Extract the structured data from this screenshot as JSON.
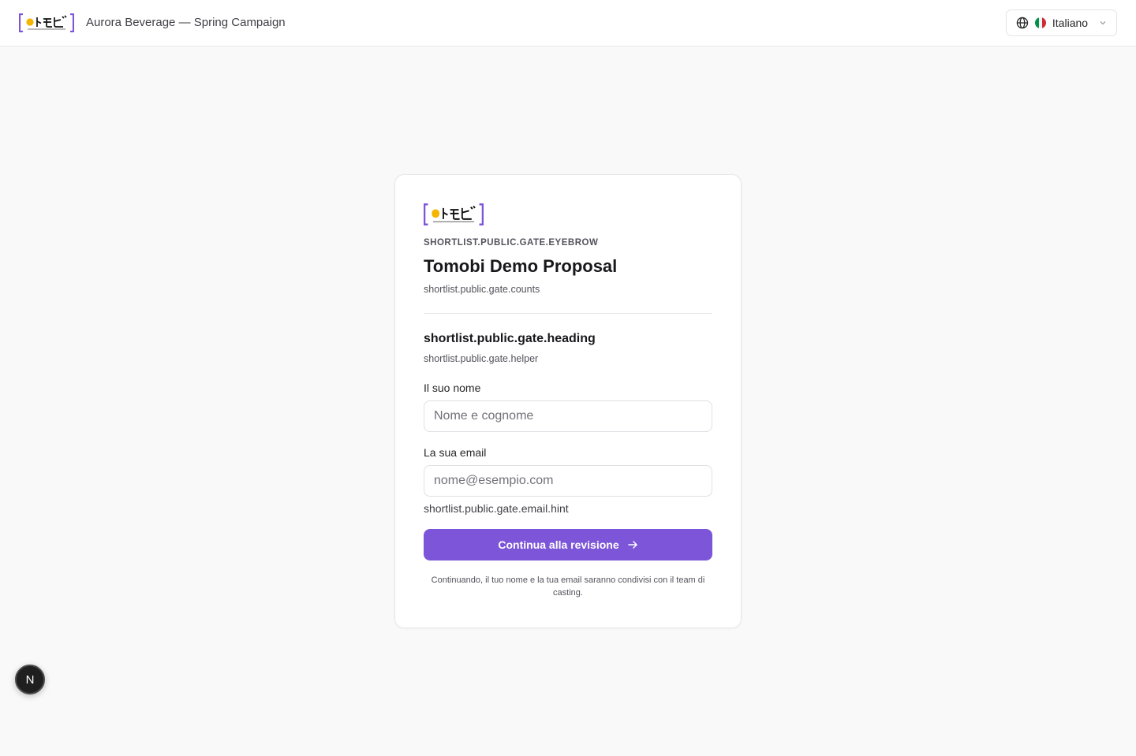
{
  "header": {
    "logo_icon": "tomobi-logo",
    "project_title": "Aurora Beverage — Spring Campaign",
    "language": {
      "globe_icon": "globe-icon",
      "flag_icon": "italy-flag-icon",
      "label": "Italiano",
      "chevron_icon": "chevron-down-icon"
    }
  },
  "card": {
    "logo_icon": "tomobi-logo",
    "eyebrow": "SHORTLIST.PUBLIC.GATE.EYEBROW",
    "title": "Tomobi Demo Proposal",
    "counts": "shortlist.public.gate.counts",
    "heading": "shortlist.public.gate.heading",
    "helper": "shortlist.public.gate.helper",
    "name_field": {
      "label": "Il suo nome",
      "placeholder": "Nome e cognome",
      "value": ""
    },
    "email_field": {
      "label": "La sua email",
      "placeholder": "nome@esempio.com",
      "value": "",
      "hint": "shortlist.public.gate.email.hint"
    },
    "submit_label": "Continua alla revisione",
    "submit_icon": "arrow-right-icon",
    "consent": "Continuando, il tuo nome e la tua email saranno condivisi con il team di casting."
  },
  "dev_badge": {
    "label": "N"
  },
  "colors": {
    "accent": "#7c55d9",
    "logo_dot": "#f5b400",
    "flag_green": "#009246",
    "flag_white": "#ffffff",
    "flag_red": "#ce2b37"
  }
}
